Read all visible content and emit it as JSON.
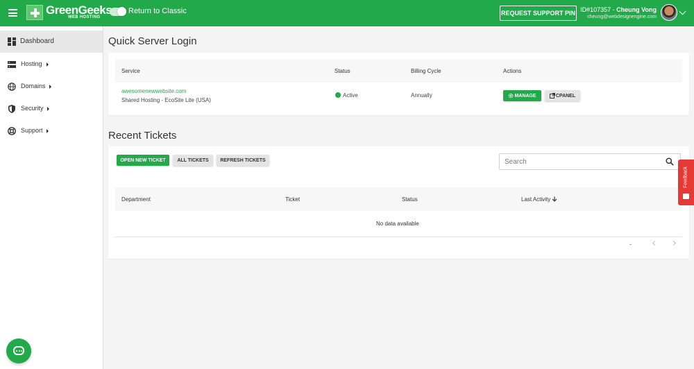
{
  "brand": {
    "name": "GreenGeeks",
    "sub": "WEB HOSTING",
    "green": "#22a94a"
  },
  "header": {
    "toggle_label": "Return to Classic",
    "support_pin": "REQUEST SUPPORT PIN",
    "user_id": "ID#107357 - ",
    "user_name": "Cheung Vong",
    "user_email": "cheung@webdesignengine.com"
  },
  "sidebar": {
    "items": [
      {
        "label": "Dashboard",
        "icon": "dashboard-icon"
      },
      {
        "label": "Hosting",
        "icon": "server-icon"
      },
      {
        "label": "Domains",
        "icon": "globe-icon"
      },
      {
        "label": "Security",
        "icon": "shield-icon"
      },
      {
        "label": "Support",
        "icon": "lifebuoy-icon"
      }
    ]
  },
  "quick_login": {
    "title": "Quick Server Login",
    "columns": [
      "Service",
      "Status",
      "Billing Cycle",
      "Actions"
    ],
    "row": {
      "domain": "awesomenewwebsite.com",
      "plan": "Shared Hosting - EcoSite Lite (USA)",
      "status": "Active",
      "billing": "Annually",
      "manage": "MANAGE",
      "cpanel": "CPANEL"
    }
  },
  "tickets": {
    "title": "Recent Tickets",
    "buttons": {
      "open": "OPEN NEW TICKET",
      "all": "ALL TICKETS",
      "refresh": "REFRESH TICKETS"
    },
    "search_placeholder": "Search",
    "columns": [
      "Department",
      "Ticket",
      "Status",
      "Last Activity"
    ],
    "empty": "No data available",
    "pager_dash": "-"
  },
  "feedback": {
    "label": "Feedback"
  }
}
